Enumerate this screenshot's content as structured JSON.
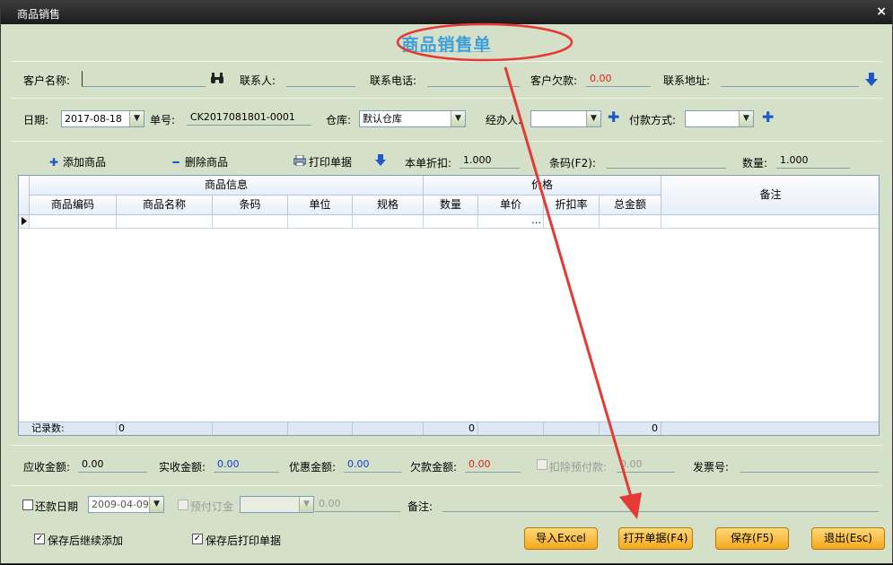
{
  "window": {
    "title": "商品销售",
    "close_symbol": "×"
  },
  "header": {
    "title": "商品销售单"
  },
  "customer": {
    "name_label": "客户名称:",
    "name_value": "",
    "contact_label": "联系人:",
    "phone_label": "联系电话:",
    "debt_label": "客户欠款:",
    "debt_value": "0.00",
    "address_label": "联系地址:"
  },
  "order": {
    "date_label": "日期:",
    "date_value": "2017-08-18",
    "number_label": "单号:",
    "number_value": "CK2017081801-0001",
    "warehouse_label": "仓库:",
    "warehouse_value": "默认仓库",
    "handler_label": "经办人:",
    "handler_value": "",
    "payment_label": "付款方式:",
    "payment_value": ""
  },
  "toolbar": {
    "add_label": "添加商品",
    "delete_label": "删除商品",
    "print_label": "打印单据",
    "discount_label": "本单折扣:",
    "discount_value": "1.000",
    "barcode_label": "条码(F2):",
    "barcode_value": "",
    "qty_label": "数量:",
    "qty_value": "1.000"
  },
  "grid": {
    "group_info": "商品信息",
    "group_price": "价格",
    "remark": "备注",
    "columns": [
      "商品编码",
      "商品名称",
      "条码",
      "单位",
      "规格",
      "数量",
      "单价",
      "折扣率",
      "总金额"
    ],
    "ellipsis": "…",
    "footer": {
      "label": "记录数:",
      "count": "0",
      "qty_total": "0",
      "amount_total": "0"
    }
  },
  "totals": {
    "receivable_label": "应收金额:",
    "receivable_value": "0.00",
    "received_label": "实收金额:",
    "received_value": "0.00",
    "discount_amt_label": "优惠金额:",
    "discount_amt_value": "0.00",
    "debt_amt_label": "欠款金额:",
    "debt_amt_value": "0.00",
    "deduct_label": "扣除预付款:",
    "deduct_value": "0.00",
    "invoice_label": "发票号:"
  },
  "bottom": {
    "repay_date_label": "还款日期",
    "repay_date_value": "2009-04-09",
    "prepay_label": "预付订金",
    "prepay_value": "0.00",
    "remark_label": "备注:",
    "continue_label": "保存后继续添加",
    "print_after_label": "保存后打印单据",
    "check_mark": "✓",
    "import_btn": "导入Excel",
    "open_btn": "打开单据(F4)",
    "save_btn": "保存(F5)",
    "exit_btn": "退出(Esc)"
  },
  "colors": {
    "accent_red": "#e53935",
    "title_blue": "#3f9fd8",
    "panel_bg": "#d5e0c8"
  }
}
